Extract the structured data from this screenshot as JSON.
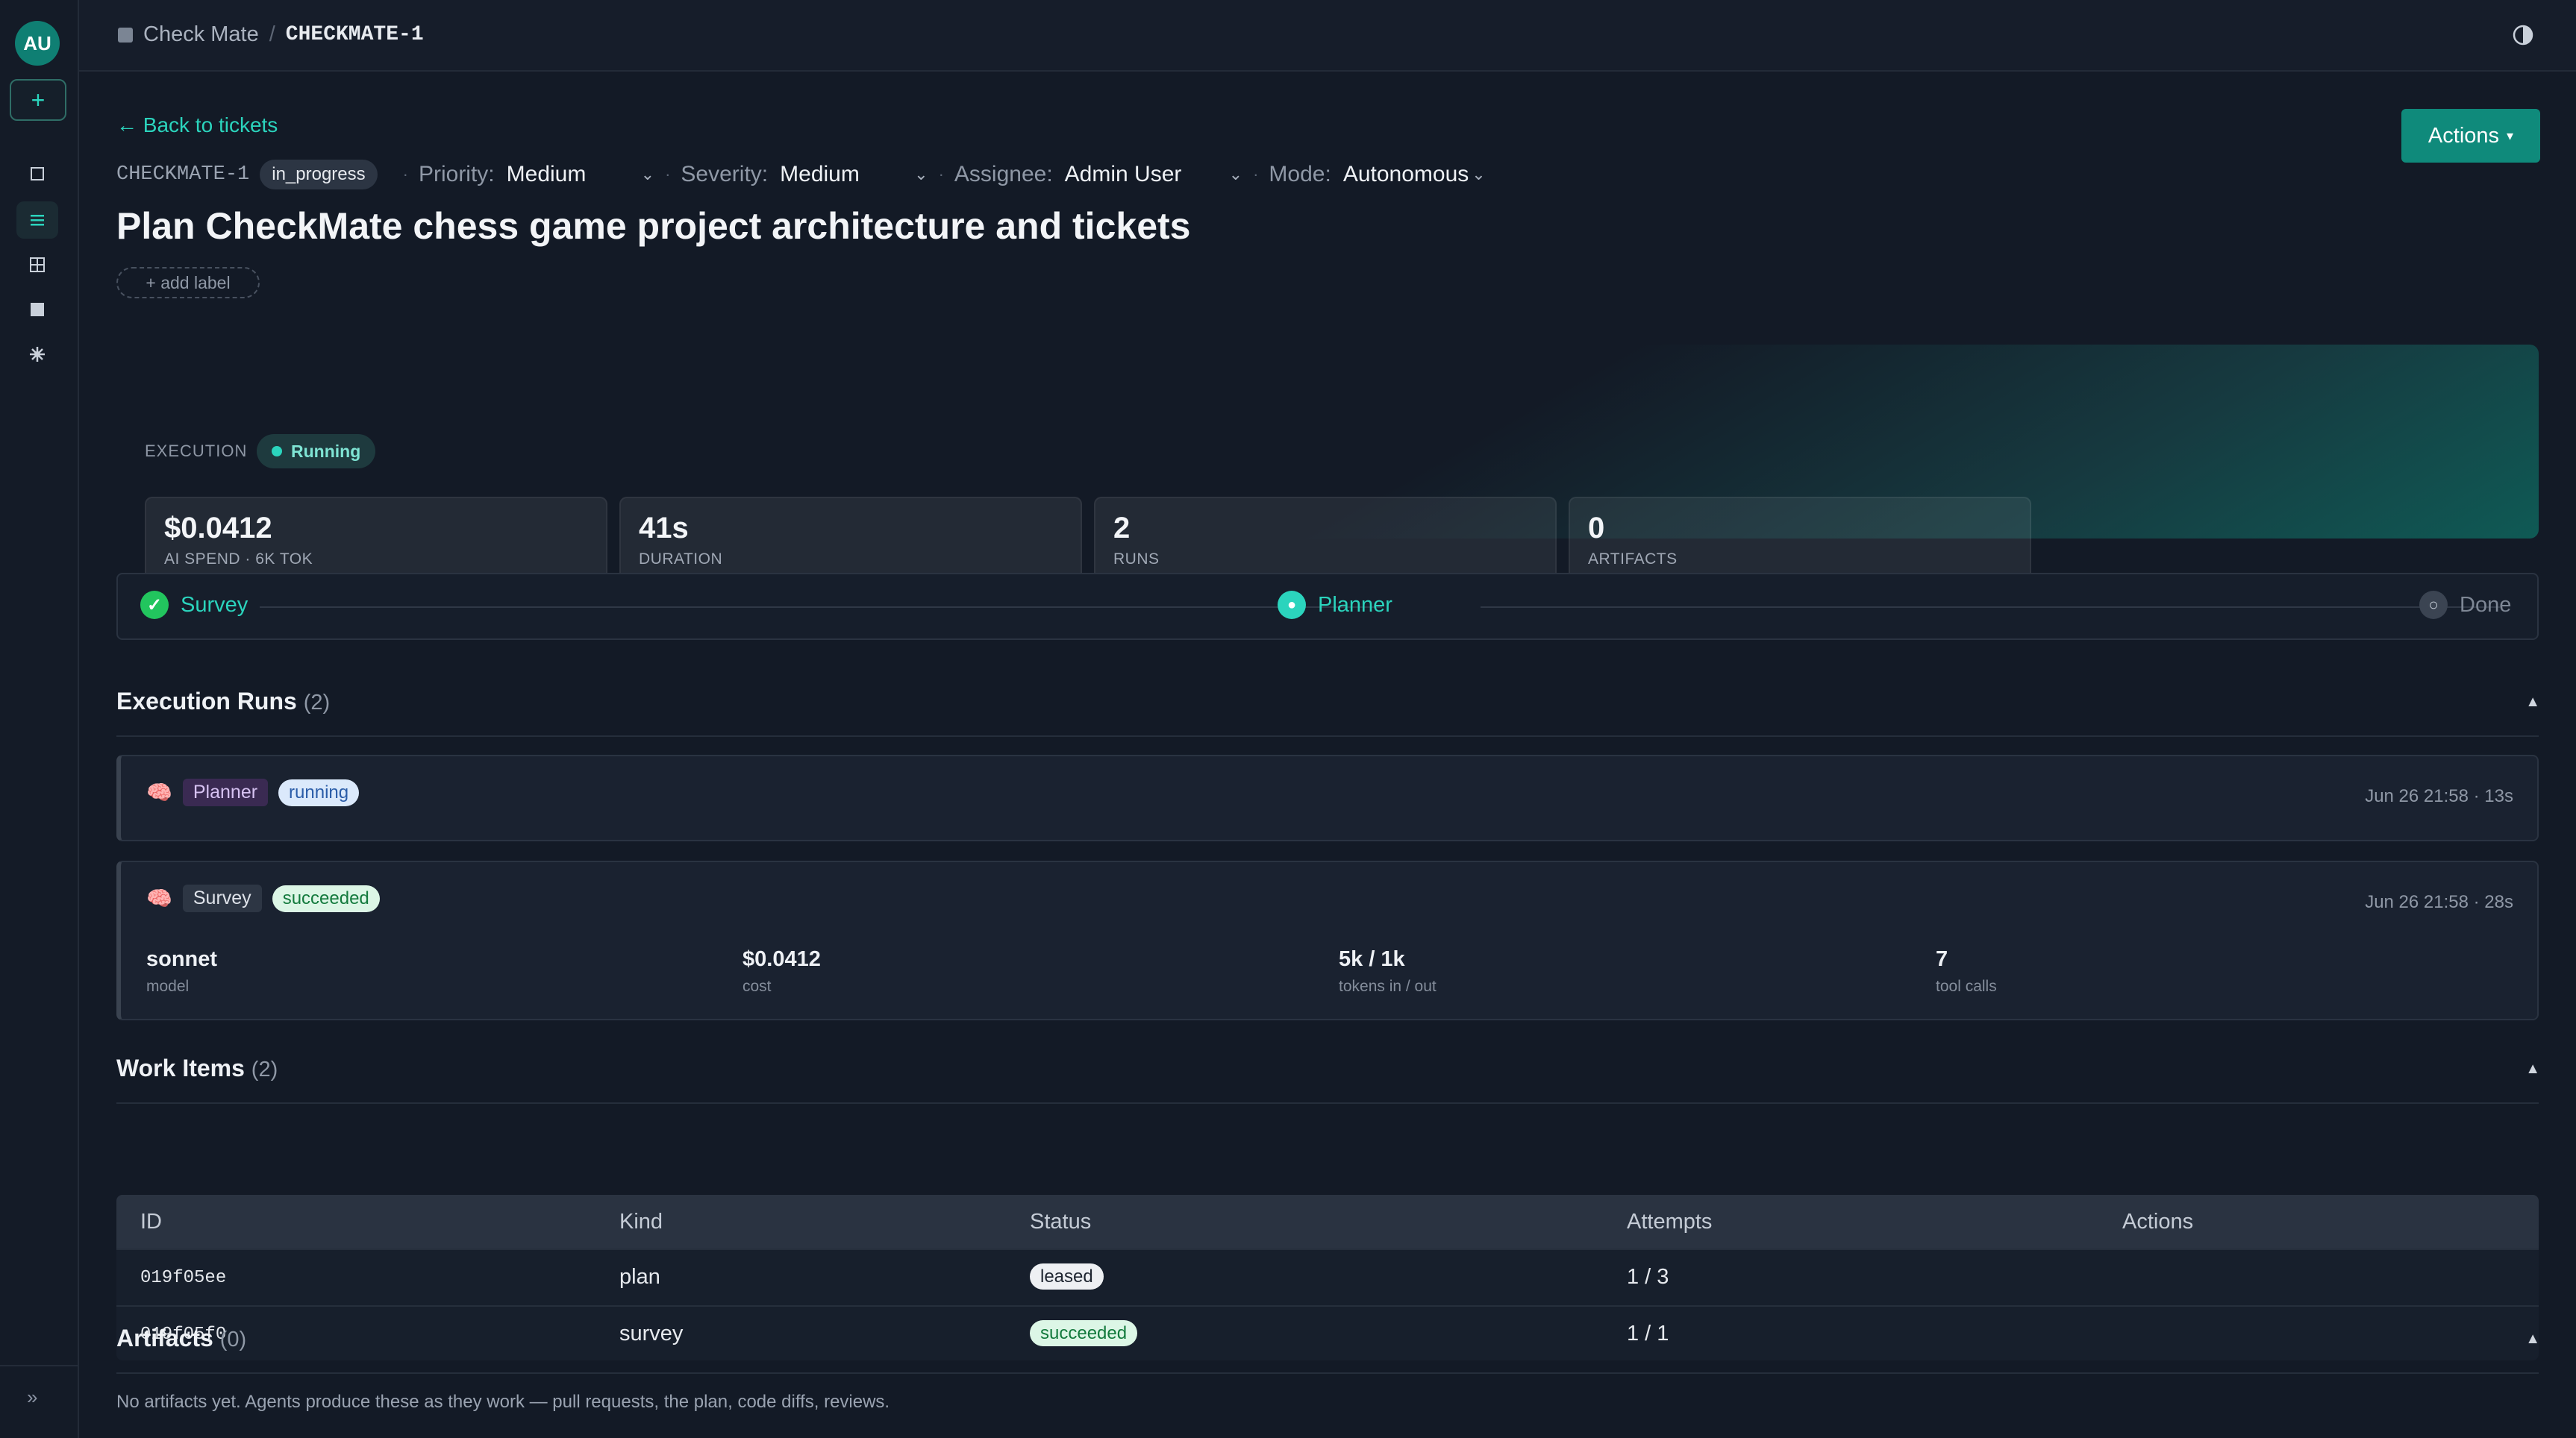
{
  "sidebar": {
    "avatar": "AU",
    "new_button": "+",
    "nav_icons": [
      "square-icon",
      "list-icon",
      "grid-icon",
      "board-icon",
      "settings-icon"
    ],
    "expand": "»"
  },
  "header": {
    "project": "Check Mate",
    "separator": "/",
    "ticket": "CHECKMATE-1"
  },
  "ticket": {
    "back_link": "← Back to tickets",
    "actions_label": "Actions",
    "actions_caret": "▾",
    "id": "CHECKMATE-1",
    "status": "in_progress",
    "priority_label": "Priority:",
    "priority": "Medium",
    "severity_label": "Severity:",
    "severity": "Medium",
    "assignee_label": "Assignee:",
    "assignee": "Admin User",
    "mode_label": "Mode:",
    "mode": "Autonomous",
    "separator": "·",
    "chevron": "⌄",
    "title": "Plan CheckMate chess game project architecture and tickets",
    "add_label": "+ add label"
  },
  "execution": {
    "label": "EXECUTION",
    "status": "Running",
    "stats": [
      {
        "value": "$0.0412",
        "label": "AI SPEND · 6K TOK"
      },
      {
        "value": "41s",
        "label": "DURATION"
      },
      {
        "value": "2",
        "label": "RUNS"
      },
      {
        "value": "0",
        "label": "ARTIFACTS"
      }
    ]
  },
  "pipeline": {
    "steps": [
      {
        "label": "Survey",
        "state": "done",
        "symbol": "✓"
      },
      {
        "label": "Planner",
        "state": "active",
        "symbol": "●"
      },
      {
        "label": "Done",
        "state": "pending",
        "symbol": "○"
      }
    ]
  },
  "runs_section": {
    "title": "Execution Runs",
    "count": "(2)",
    "toggle": "▲",
    "runs": [
      {
        "stage": "Planner",
        "status": "running",
        "time": "Jun 26 21:58 · 13s"
      },
      {
        "stage": "Survey",
        "status": "succeeded",
        "time": "Jun 26 21:58 · 28s",
        "stats": [
          {
            "value": "sonnet",
            "label": "model"
          },
          {
            "value": "$0.0412",
            "label": "cost"
          },
          {
            "value": "5k / 1k",
            "label": "tokens in / out"
          },
          {
            "value": "7",
            "label": "tool calls"
          }
        ]
      }
    ]
  },
  "work_items": {
    "title": "Work Items",
    "count": "(2)",
    "toggle": "▲",
    "columns": [
      "ID",
      "Kind",
      "Status",
      "Attempts",
      "Actions"
    ],
    "rows": [
      {
        "id": "019f05ee",
        "kind": "plan",
        "status": "leased",
        "attempts": "1 / 3"
      },
      {
        "id": "019f05f0",
        "kind": "survey",
        "status": "succeeded",
        "attempts": "1 / 1"
      }
    ]
  },
  "artifacts": {
    "title": "Artifacts",
    "count": "(0)",
    "toggle": "▲",
    "empty": "No artifacts yet. Agents produce these as they work — pull requests, the plan, code diffs, reviews."
  },
  "colors": {
    "accent": "#2bd4bd",
    "accent_button": "#0f8a7b",
    "background": "#131a26",
    "success": "#22c55e"
  }
}
